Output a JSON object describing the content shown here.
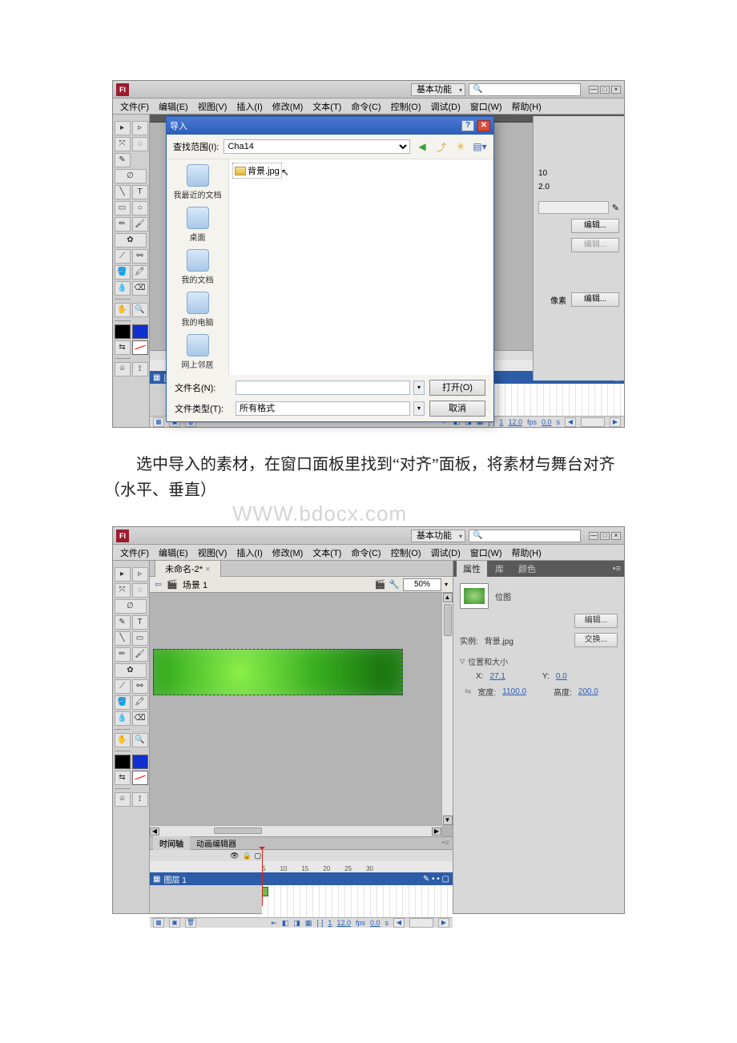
{
  "top": {
    "workspace": "基本功能",
    "search_placeholder": ""
  },
  "menu1": [
    "文件(F)",
    "编辑(E)",
    "视图(V)",
    "插入(I)",
    "修改(M)",
    "文本(T)",
    "命令(C)",
    "控制(O)",
    "调试(D)",
    "窗口(W)",
    "帮助(H)"
  ],
  "menu2": [
    "文件(F)",
    "编辑(E)",
    "视图(V)",
    "插入(I)",
    "修改(M)",
    "文本(T)",
    "命令(C)",
    "控制(O)",
    "调试(D)",
    "窗口(W)",
    "帮助(H)"
  ],
  "dialog": {
    "title": "导入",
    "lookin_label": "查找范围(I):",
    "lookin_value": "Cha14",
    "file_item": "背景.jpg",
    "places": [
      "我最近的文档",
      "桌面",
      "我的文档",
      "我的电脑",
      "网上邻居"
    ],
    "filename_label": "文件名(N):",
    "filetype_label": "文件类型(T):",
    "filetype_value": "所有格式",
    "open_btn": "打开(O)",
    "cancel_btn": "取消"
  },
  "peek1": {
    "v1": "10",
    "v2": "2.0",
    "edit": "编辑...",
    "px_label": "像素"
  },
  "timeline": {
    "tabs": [
      "时间轴",
      "动画编辑器"
    ],
    "layer": "图层 1",
    "marks": [
      "5",
      "10",
      "15",
      "20",
      "25",
      "30"
    ],
    "frame": "1",
    "fps": "12.0",
    "fps_unit": "fps",
    "time": "0.0",
    "time_unit": "s"
  },
  "instruction_text": "选中导入的素材，在窗口面板里找到“对齐”面板，将素材与舞台对齐（水平、垂直）",
  "watermark": "WWW.bdocx.com",
  "doc2": {
    "tab": "未命名-2*",
    "scene": "场景 1",
    "zoom": "50%"
  },
  "panels": {
    "tabs": [
      "属性",
      "库",
      "颜色"
    ],
    "type_label": "位图",
    "edit_btn": "编辑...",
    "instance_label": "实例:",
    "instance_value": "背景.jpg",
    "swap_btn": "交换...",
    "section": "位置和大小",
    "x_label": "X:",
    "x_val": "27.1",
    "y_label": "Y:",
    "y_val": "0.0",
    "w_label": "宽度:",
    "w_val": "1100.0",
    "h_label": "高度:",
    "h_val": "200.0"
  }
}
